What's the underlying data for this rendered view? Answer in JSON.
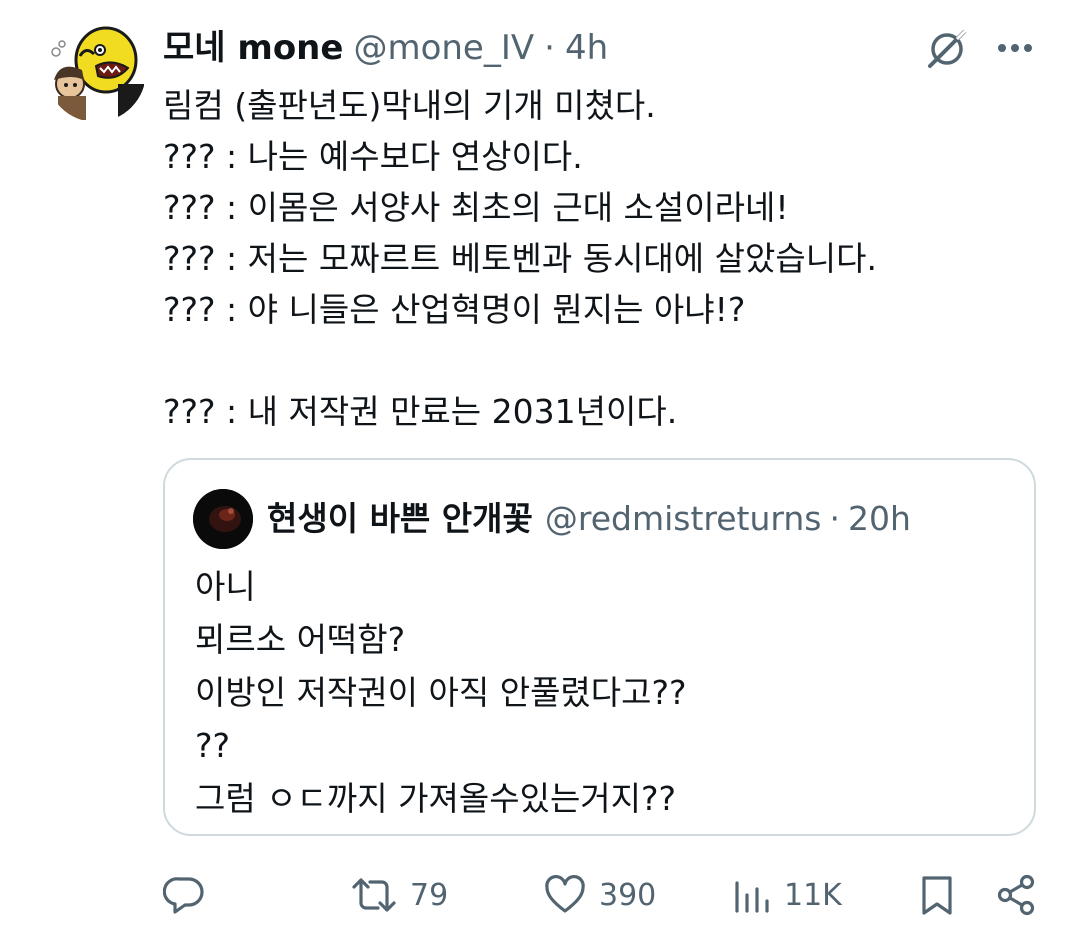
{
  "tweet": {
    "display_name": "모네 mone",
    "handle": "@mone_IV",
    "separator": "·",
    "time": "4h",
    "lines": [
      "림컴 (출판년도)막내의 기개 미쳤다.",
      "??? : 나는 예수보다 연상이다.",
      "??? : 이몸은 서양사 최초의 근대 소설이라네!",
      "??? : 저는 모짜르트 베토벤과 동시대에 살았습니다.",
      "??? : 야 니들은 산업혁명이 뭔지는 아냐!?",
      "",
      "??? : 내 저작권 만료는 2031년이다."
    ]
  },
  "quote": {
    "display_name": "현생이 바쁜 안개꽃",
    "handle": "@redmistreturns",
    "separator": "·",
    "time": "20h",
    "lines": [
      "아니",
      "뫼르소 어떡함?",
      "이방인 저작권이 아직 안풀렸다고??",
      "??",
      "그럼 ㅇㄷ까지 가져올수있는거지??"
    ]
  },
  "actions": {
    "reply_count": "",
    "retweet_count": "79",
    "like_count": "390",
    "views_count": "11K"
  },
  "icons": {
    "avatar": "cartoon-avatar",
    "quote_avatar": "dark-photo-avatar",
    "grok": "grok-icon",
    "more": "more-icon",
    "reply": "reply-icon",
    "retweet": "retweet-icon",
    "like": "heart-icon",
    "views": "views-icon",
    "bookmark": "bookmark-icon",
    "share": "share-icon"
  },
  "colors": {
    "text": "#0f1419",
    "secondary": "#536471",
    "border": "#cfd9de"
  }
}
